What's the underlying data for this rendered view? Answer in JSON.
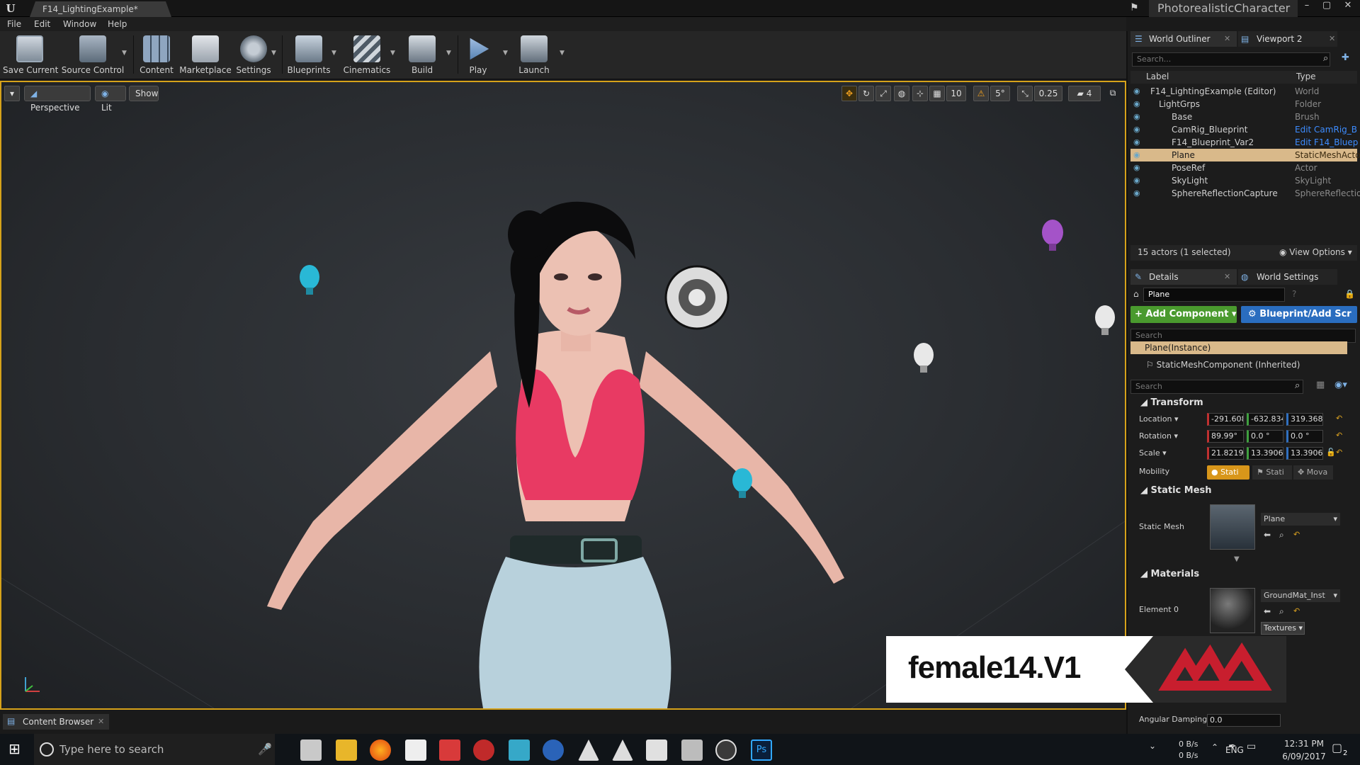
{
  "window": {
    "doc_tab": "F14_LightingExample*",
    "project": "PhotorealisticCharacter"
  },
  "menu": [
    "File",
    "Edit",
    "Window",
    "Help"
  ],
  "toolbar": [
    "Save Current",
    "Source Control",
    "Content",
    "Marketplace",
    "Settings",
    "Blueprints",
    "Cinematics",
    "Build",
    "Play",
    "Launch"
  ],
  "viewport": {
    "perspective": "Perspective",
    "lit": "Lit",
    "show": "Show",
    "grid_snap": "10",
    "rot_snap": "5°",
    "scale_snap": "0.25",
    "cam_speed": "4"
  },
  "outliner": {
    "tab": "World Outliner",
    "tab2": "Viewport 2",
    "search_placeholder": "Search...",
    "col_label": "Label",
    "col_type": "Type",
    "rows": [
      {
        "label": "F14_LightingExample (Editor)",
        "type": "World"
      },
      {
        "label": "LightGrps",
        "type": "Folder"
      },
      {
        "label": "Base",
        "type": "Brush"
      },
      {
        "label": "CamRig_Blueprint",
        "type": "Edit CamRig_B"
      },
      {
        "label": "F14_Blueprint_Var2",
        "type": "Edit F14_Bluep"
      },
      {
        "label": "Plane",
        "type": "StaticMeshActo"
      },
      {
        "label": "PoseRef",
        "type": "Actor"
      },
      {
        "label": "SkyLight",
        "type": "SkyLight"
      },
      {
        "label": "SphereReflectionCapture",
        "type": "SphereReflectio"
      }
    ],
    "count": "15 actors (1 selected)",
    "view_options": "View Options"
  },
  "details": {
    "tab": "Details",
    "tab2": "World Settings",
    "name": "Plane",
    "add_component": "+ Add Component",
    "blueprint": "Blueprint/Add Scr",
    "search_placeholder": "Search",
    "comp_instance": "Plane(Instance)",
    "comp_child": "StaticMeshComponent (Inherited)",
    "search2_placeholder": "Search",
    "transform": "Transform",
    "location_label": "Location",
    "rotation_label": "Rotation",
    "scale_label": "Scale",
    "mobility_label": "Mobility",
    "location": [
      "-291.608",
      "-632.834",
      "319.3684"
    ],
    "rotation": [
      "89.99°",
      "0.0 °",
      "0.0 °"
    ],
    "scale": [
      "21.82197",
      "13.39061",
      "13.39061"
    ],
    "mobility": [
      "Stati",
      "Stati",
      "Mova"
    ],
    "static_mesh_section": "Static Mesh",
    "static_mesh_label": "Static Mesh",
    "static_mesh_value": "Plane",
    "materials_section": "Materials",
    "element0": "Element 0",
    "material_value": "GroundMat_Inst",
    "textures": "Textures",
    "angular_damping": "Angular Damping",
    "angular_damping_value": "0.0"
  },
  "watermark": "female14.V1",
  "content_browser": "Content Browser",
  "taskbar": {
    "search": "Type here to search",
    "net_up": "0 B/s",
    "net_down": "0 B/s",
    "lang": "ENG",
    "time": "12:31 PM",
    "date": "6/09/2017",
    "notif": "2"
  }
}
